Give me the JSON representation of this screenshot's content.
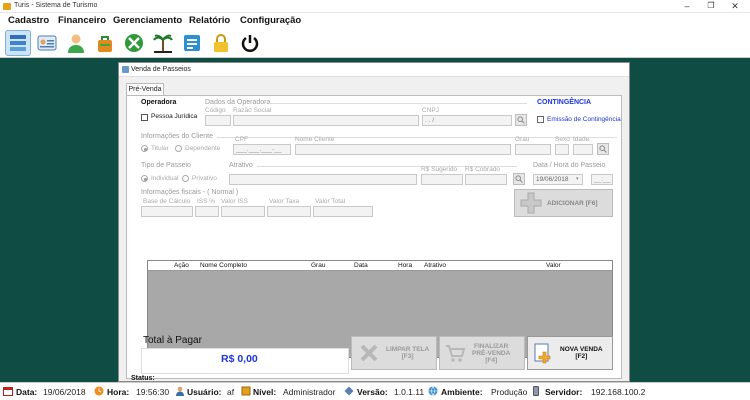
{
  "app": {
    "title": "Turis - Sistema de Turismo"
  },
  "menu": [
    "Cadastro",
    "Financeiro",
    "Gerenciamento",
    "Relatório",
    "Configuração"
  ],
  "window": {
    "title": "Venda de Passeios",
    "tab": "Pré-Venda"
  },
  "operadora": {
    "group": "Operadora",
    "pessoa_juridica": "Pessoa Jurídica"
  },
  "dados_operadora": {
    "group": "Dados da Operadora",
    "codigo": "Código",
    "razao_social": "Razão Social",
    "cnpj": "CNPJ",
    "cnpj_value": ". . /"
  },
  "contingencia": {
    "group": "CONTINGÊNCIA",
    "emissao": "Emissão de Contingência"
  },
  "cliente": {
    "group": "Informações do Cliente",
    "titular": "Titular",
    "dependente": "Dependente",
    "cpf": "CPF",
    "cpf_value": "___.___.___-__",
    "nome": "Nome Cliente",
    "grau": "Grau",
    "sexo": "Sexo",
    "idade": "Idade"
  },
  "tipo_passeio": {
    "group": "Tipo de Passeio",
    "individual": "Individual",
    "privativo": "Privativo"
  },
  "atrativo": {
    "group": "Atrativo",
    "rs_sugerido": "R$ Sugerido",
    "rs_cobrado": "R$ Cobrado"
  },
  "data_hora": {
    "group": "Data / Hora do Passeio",
    "date": "19/06/2018",
    "time": "__:__"
  },
  "fiscais": {
    "group": "Informações fiscais - ( Normal )",
    "base": "Base de Cálculo",
    "iss_pct": "ISS %",
    "valor_iss": "Valor ISS",
    "valor_taxa": "Valor Taxa",
    "valor_total": "Valor Total"
  },
  "buttons": {
    "adicionar": "ADICIONAR [F6]",
    "limpar_1": "LIMPAR TELA",
    "limpar_2": "[F3]",
    "finalizar_1": "FINALIZAR",
    "finalizar_2": "PRÉ-VENDA",
    "finalizar_3": "[F4]",
    "nova_1": "NOVA VENDA",
    "nova_2": "[F2]"
  },
  "grid": {
    "columns": [
      "Ação",
      "Nome Completo",
      "Grau",
      "Data",
      "Hora",
      "Atrativo",
      "Valor"
    ]
  },
  "total": {
    "label": "Total à Pagar",
    "value": "R$ 0,00"
  },
  "status_label": "Status:",
  "statusbar": {
    "data_label": "Data:",
    "data": "19/06/2018",
    "hora_label": "Hora:",
    "hora": "19:56:30",
    "usuario_label": "Usuário:",
    "usuario": "af",
    "nivel_label": "Nível:",
    "nivel": "Administrador",
    "versao_label": "Versão:",
    "versao": "1.0.1.11",
    "ambiente_label": "Ambiente:",
    "ambiente": "Produção",
    "servidor_label": "Servidor:",
    "servidor": "192.168.100.2"
  },
  "colors": {
    "background": "#0f4c44",
    "total_value": "#1a34d6",
    "contingencia": "#1a34d6"
  },
  "toolbar_icons": [
    "layers-icon",
    "id-card-icon",
    "user-icon",
    "bag-icon",
    "tools-icon",
    "beach-icon",
    "ticket-icon",
    "lock-icon",
    "power-icon"
  ]
}
